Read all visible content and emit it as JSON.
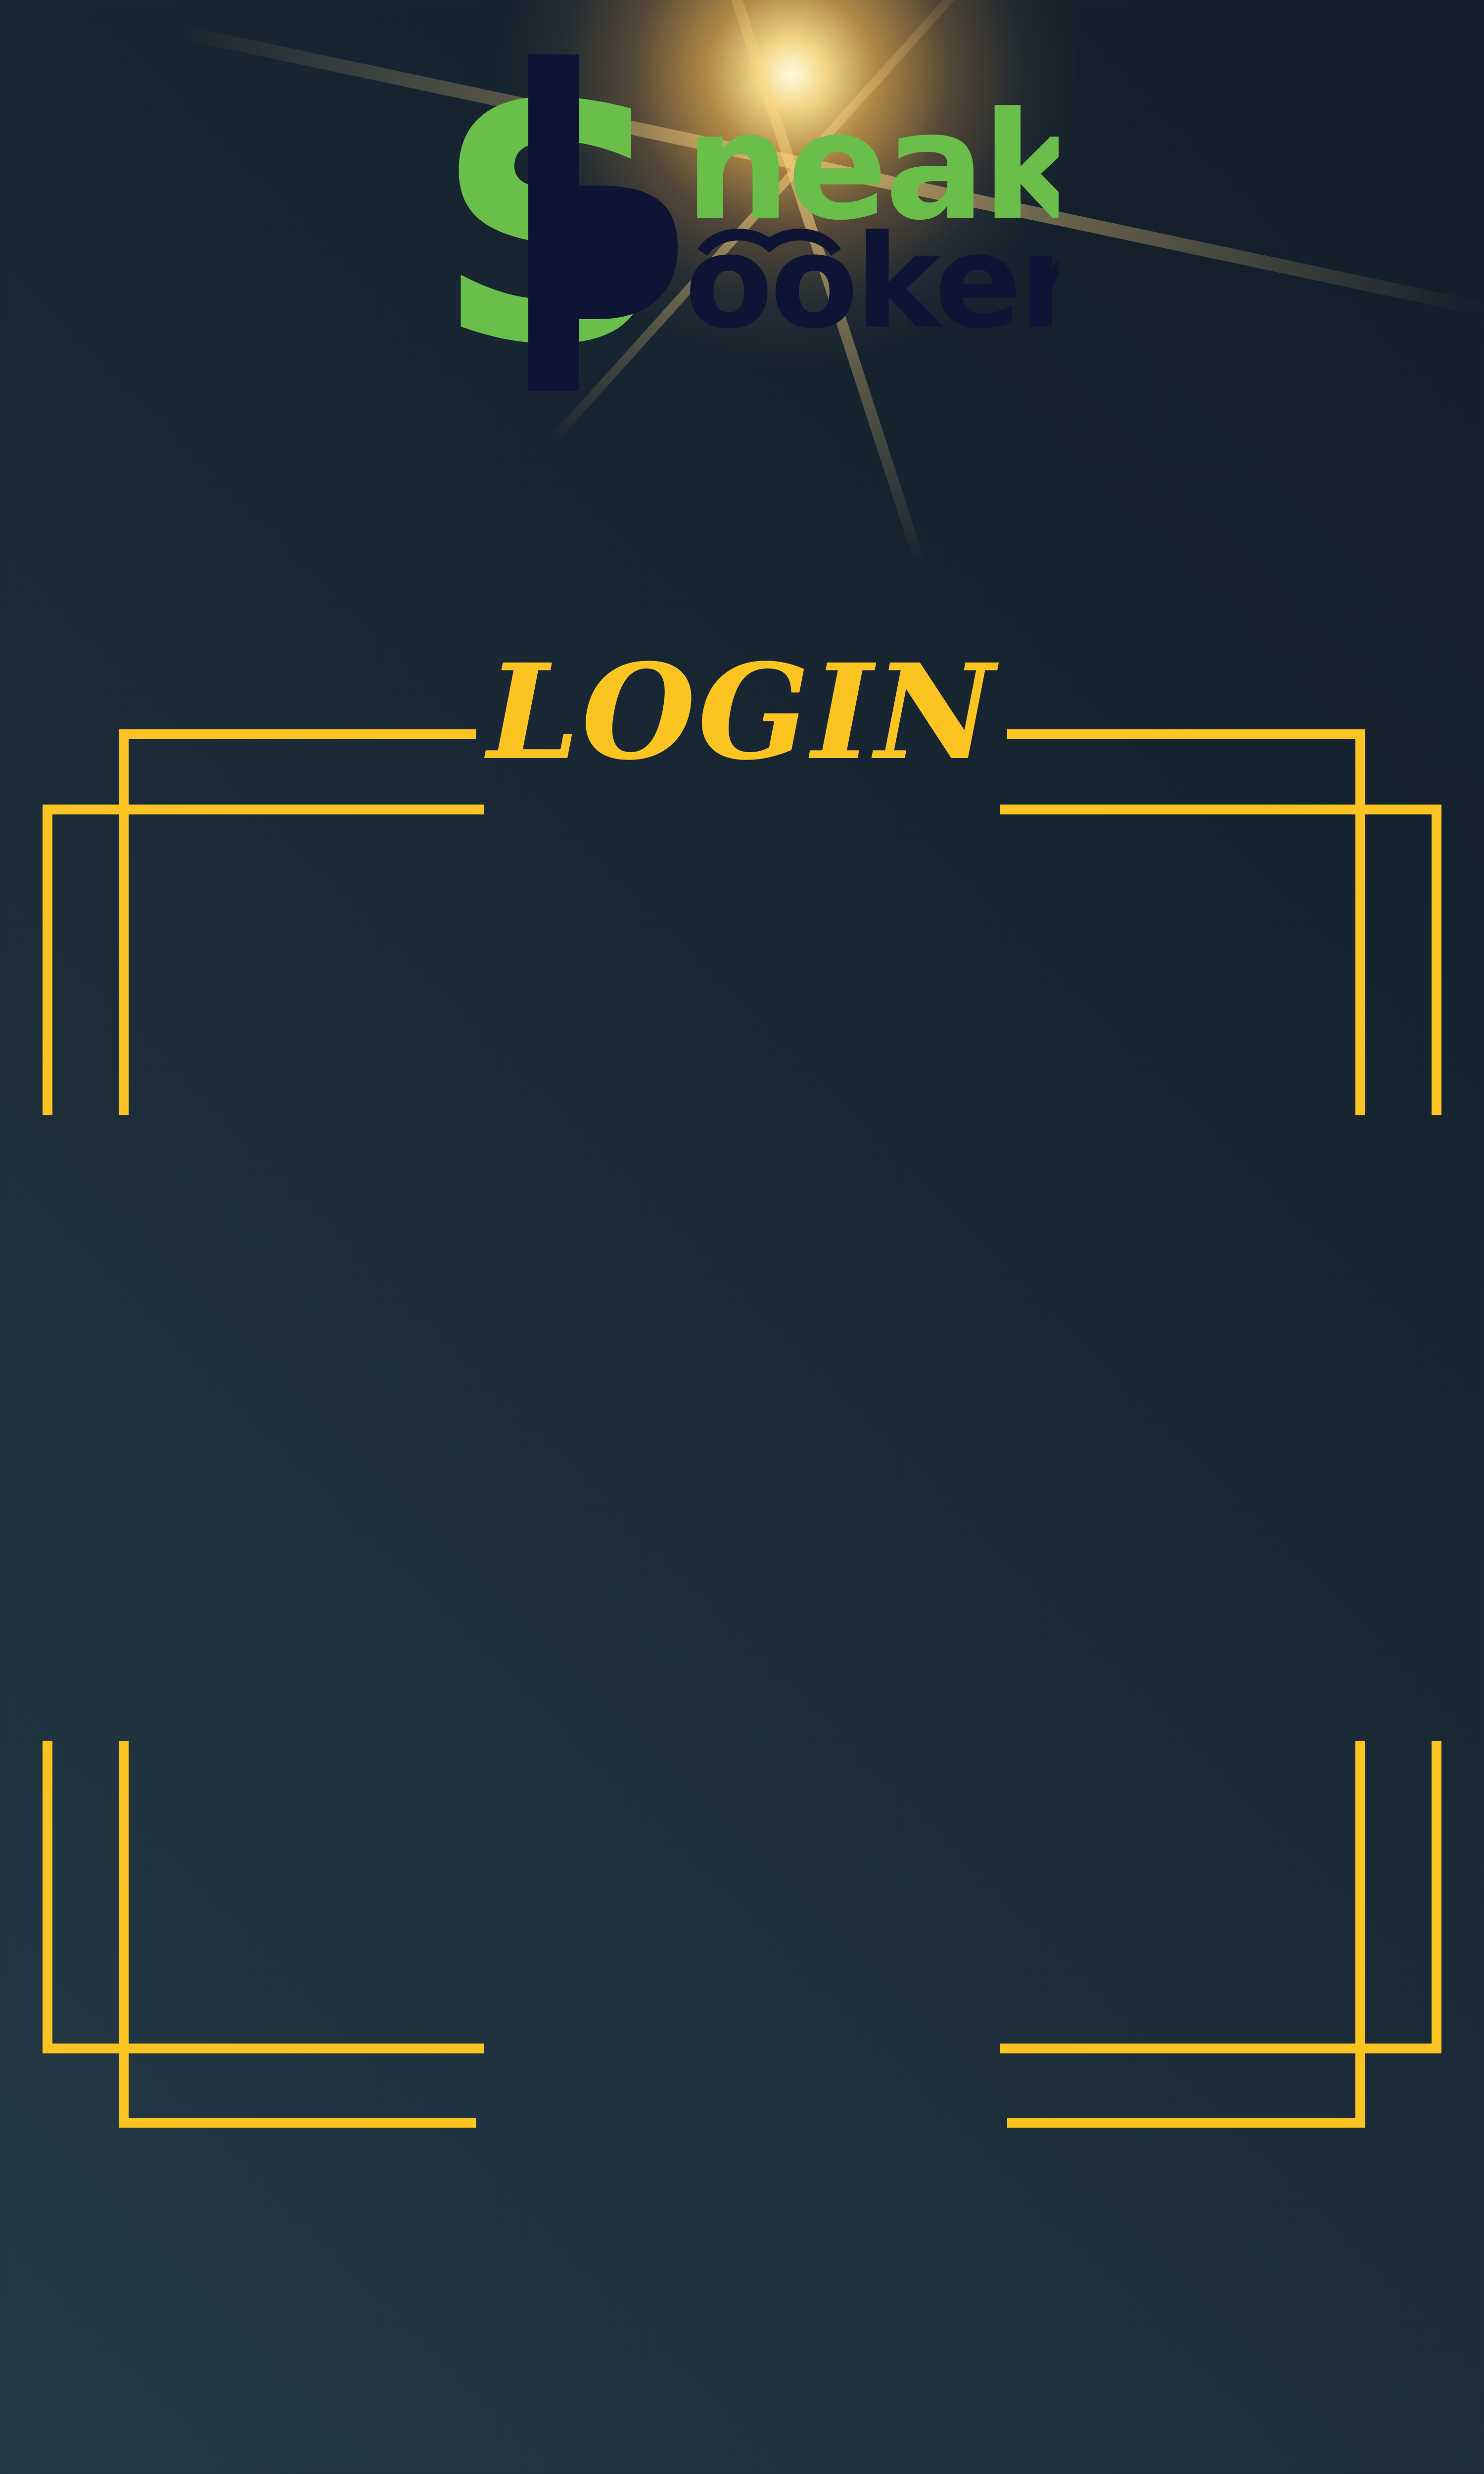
{
  "brand": {
    "logo_alt": "SneakBooker",
    "line1": "neak",
    "line2": "ooker",
    "dollar_letter": "S",
    "colors": {
      "green": "#6abf4b",
      "navy": "#0e1434",
      "glow": "#f6c35a"
    }
  },
  "screen": {
    "title": "LOGIN"
  },
  "theme": {
    "accent": "#fbc421",
    "background_top": "#243a47",
    "background_bottom": "#111d28"
  },
  "icons": {
    "logo": "sneakbooker-logo",
    "frame": "double-line-corner-frame"
  }
}
